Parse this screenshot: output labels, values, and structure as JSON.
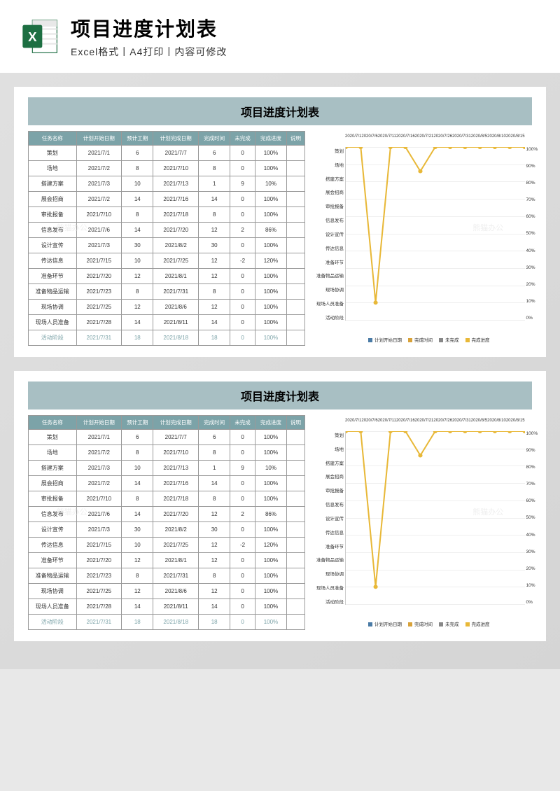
{
  "header": {
    "title": "项目进度计划表",
    "subtitle": "Excel格式丨A4打印丨内容可修改"
  },
  "watermark": "熊猫办公",
  "panel": {
    "title": "项目进度计划表",
    "columns": [
      "任务名称",
      "计划开始日期",
      "预计工期",
      "计划完成日期",
      "完成时间",
      "未完成",
      "完成进度",
      "说明"
    ],
    "rows": [
      {
        "name": "策划",
        "start": "2021/7/1",
        "dur": "6",
        "end": "2021/7/7",
        "done": "6",
        "undone": "0",
        "pct": "100%",
        "note": ""
      },
      {
        "name": "场地",
        "start": "2021/7/2",
        "dur": "8",
        "end": "2021/7/10",
        "done": "8",
        "undone": "0",
        "pct": "100%",
        "note": ""
      },
      {
        "name": "搭建方案",
        "start": "2021/7/3",
        "dur": "10",
        "end": "2021/7/13",
        "done": "1",
        "undone": "9",
        "pct": "10%",
        "note": ""
      },
      {
        "name": "展会招商",
        "start": "2021/7/2",
        "dur": "14",
        "end": "2021/7/16",
        "done": "14",
        "undone": "0",
        "pct": "100%",
        "note": ""
      },
      {
        "name": "审批报备",
        "start": "2021/7/10",
        "dur": "8",
        "end": "2021/7/18",
        "done": "8",
        "undone": "0",
        "pct": "100%",
        "note": ""
      },
      {
        "name": "信息发布",
        "start": "2021/7/6",
        "dur": "14",
        "end": "2021/7/20",
        "done": "12",
        "undone": "2",
        "pct": "86%",
        "note": ""
      },
      {
        "name": "设计宣传",
        "start": "2021/7/3",
        "dur": "30",
        "end": "2021/8/2",
        "done": "30",
        "undone": "0",
        "pct": "100%",
        "note": ""
      },
      {
        "name": "传达信息",
        "start": "2021/7/15",
        "dur": "10",
        "end": "2021/7/25",
        "done": "12",
        "undone": "-2",
        "pct": "120%",
        "note": ""
      },
      {
        "name": "准备环节",
        "start": "2021/7/20",
        "dur": "12",
        "end": "2021/8/1",
        "done": "12",
        "undone": "0",
        "pct": "100%",
        "note": ""
      },
      {
        "name": "准备物品运输",
        "start": "2021/7/23",
        "dur": "8",
        "end": "2021/7/31",
        "done": "8",
        "undone": "0",
        "pct": "100%",
        "note": ""
      },
      {
        "name": "现场协调",
        "start": "2021/7/25",
        "dur": "12",
        "end": "2021/8/6",
        "done": "12",
        "undone": "0",
        "pct": "100%",
        "note": ""
      },
      {
        "name": "现场人员准备",
        "start": "2021/7/28",
        "dur": "14",
        "end": "2021/8/11",
        "done": "14",
        "undone": "0",
        "pct": "100%",
        "note": ""
      }
    ],
    "summary": {
      "name": "活动阶段",
      "start": "2021/7/31",
      "dur": "18",
      "end": "2021/8/18",
      "done": "18",
      "undone": "0",
      "pct": "100%",
      "note": ""
    }
  },
  "chart_data": {
    "type": "line",
    "x_ticks": [
      "2020/7/1",
      "2020/7/6",
      "2020/7/11",
      "2020/7/16",
      "2020/7/21",
      "2020/7/26",
      "2020/7/31",
      "2020/8/5",
      "2020/8/10",
      "2020/8/15"
    ],
    "y_categories": [
      "策划",
      "场地",
      "搭建方案",
      "展会招商",
      "审批报备",
      "信息发布",
      "设计宣传",
      "传达信息",
      "准备环节",
      "准备物品运输",
      "现场协调",
      "现场人员准备",
      "活动阶段"
    ],
    "y_pct": [
      "100%",
      "90%",
      "80%",
      "70%",
      "60%",
      "50%",
      "40%",
      "30%",
      "20%",
      "10%",
      "0%"
    ],
    "series": [
      {
        "name": "计划开始日期",
        "color": "#4a7ba6"
      },
      {
        "name": "完成时间",
        "color": "#d8a23a"
      },
      {
        "name": "未完成",
        "color": "#888"
      },
      {
        "name": "完成进度",
        "color": "#e8b838"
      }
    ],
    "progress_values": [
      100,
      100,
      10,
      100,
      100,
      86,
      100,
      120,
      100,
      100,
      100,
      100,
      100
    ]
  }
}
